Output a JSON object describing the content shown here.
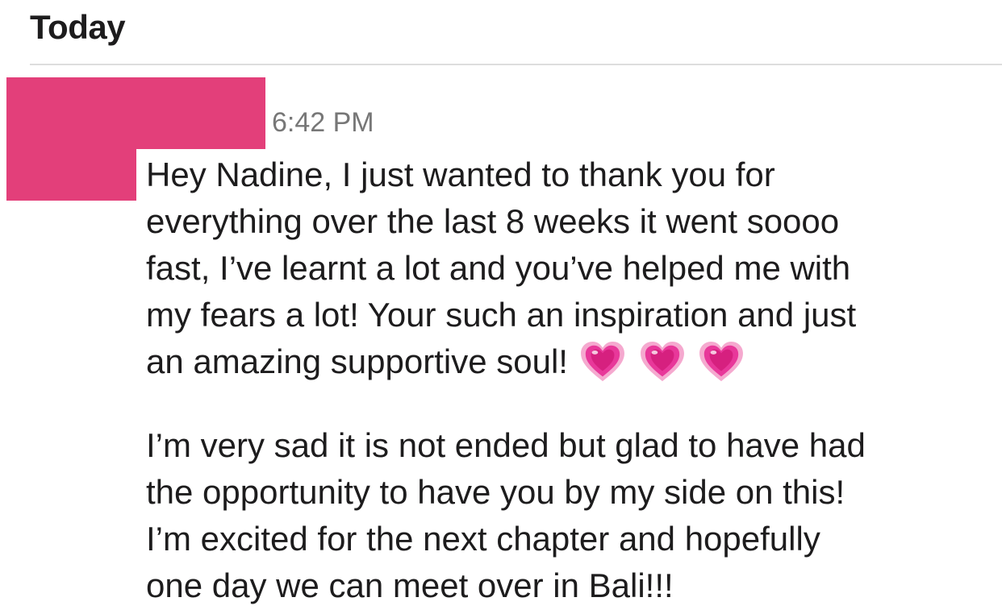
{
  "day_header": "Today",
  "message": {
    "time": "6:42 PM",
    "paragraph_1": {
      "line_1": "Hey Nadine, I just wanted to thank you for",
      "line_2": "everything over the last 8 weeks it went soooo",
      "line_3": "fast, I’ve learnt a lot and you’ve helped me with",
      "line_4": "my fears a lot! Your such an inspiration and just",
      "line_5": "an amazing supportive soul!"
    },
    "emoji": [
      "growing-heart-icon",
      "growing-heart-icon",
      "growing-heart-icon"
    ],
    "paragraph_2": {
      "line_1": "I’m very sad it is not ended but glad to have had",
      "line_2": "the opportunity to have you by my side on this!",
      "line_3": "I’m excited for the next chapter and hopefully",
      "line_4": "one day we can meet over in Bali!!!"
    }
  },
  "colors": {
    "redaction": "#e33f7a",
    "heart": "#e8389a",
    "timestamp": "#777777",
    "divider": "#dddddd"
  }
}
